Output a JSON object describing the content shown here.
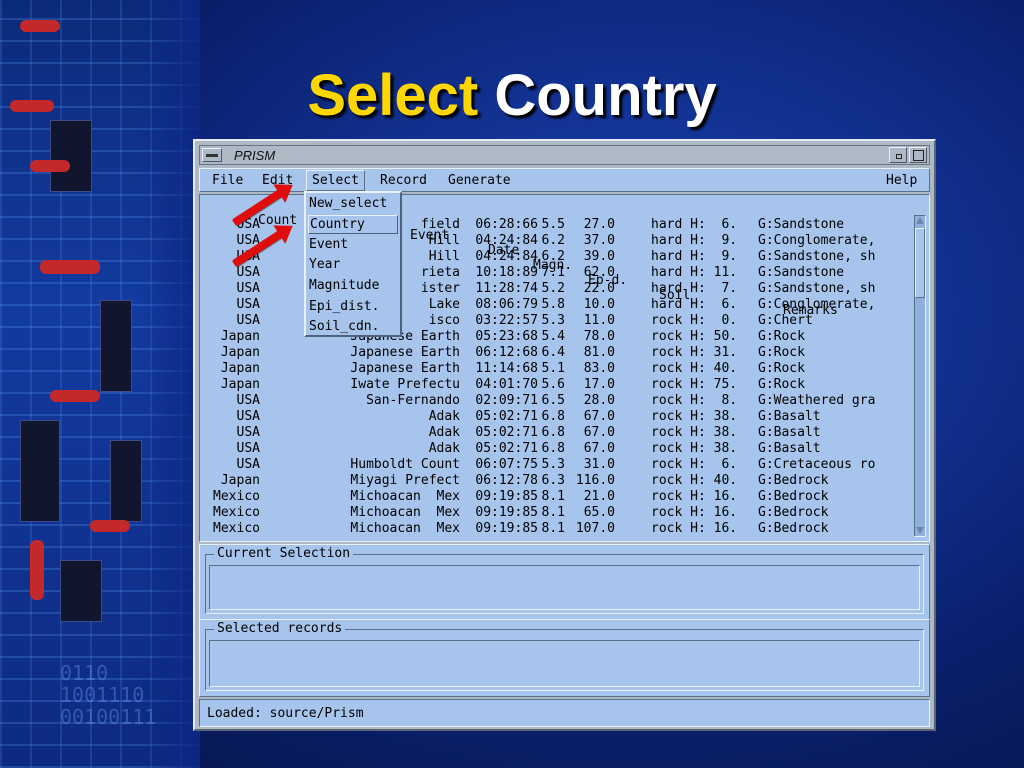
{
  "slide": {
    "title_highlight": "Select",
    "title_rest": "Country"
  },
  "decoration": {
    "binary_text": "0110\n1001110\n00100111"
  },
  "window": {
    "title": "PRISM",
    "menu": {
      "file": "File",
      "edit": "Edit",
      "select": "Select",
      "record": "Record",
      "generate": "Generate",
      "help": "Help"
    }
  },
  "dropdown": {
    "items": [
      "New_select",
      "Country",
      "Event",
      "Year",
      "Magnitude",
      "Epi_dist.",
      "Soil_cdn."
    ],
    "selected": "Country"
  },
  "table": {
    "columns": [
      "Count",
      "Event",
      "Date",
      "Magn.",
      "Ep-d.",
      "Soil",
      "Remarks"
    ],
    "rows": [
      [
        "USA",
        "field",
        "06:28:66",
        "5.5",
        "27.0",
        "hard H:  6.",
        "G:Sandstone"
      ],
      [
        "USA",
        "Hill",
        "04:24:84",
        "6.2",
        "37.0",
        "hard H:  9.",
        "G:Conglomerate,"
      ],
      [
        "USA",
        "Hill",
        "04:24:84",
        "6.2",
        "39.0",
        "hard H:  9.",
        "G:Sandstone, sh"
      ],
      [
        "USA",
        "rieta",
        "10:18:89",
        "7.1",
        "62.0",
        "hard H: 11.",
        "G:Sandstone"
      ],
      [
        "USA",
        "ister",
        "11:28:74",
        "5.2",
        "22.0",
        "hard H:  7.",
        "G:Sandstone, sh"
      ],
      [
        "USA",
        "Lake",
        "08:06:79",
        "5.8",
        "10.0",
        "hard H:  6.",
        "G:Conglomerate,"
      ],
      [
        "USA",
        "isco",
        "03:22:57",
        "5.3",
        "11.0",
        "rock H:  0.",
        "G:Chert"
      ],
      [
        "Japan",
        "Japanese Earth",
        "05:23:68",
        "5.4",
        "78.0",
        "rock H: 50.",
        "G:Rock"
      ],
      [
        "Japan",
        "Japanese Earth",
        "06:12:68",
        "6.4",
        "81.0",
        "rock H: 31.",
        "G:Rock"
      ],
      [
        "Japan",
        "Japanese Earth",
        "11:14:68",
        "5.1",
        "83.0",
        "rock H: 40.",
        "G:Rock"
      ],
      [
        "Japan",
        "Iwate Prefectu",
        "04:01:70",
        "5.6",
        "17.0",
        "rock H: 75.",
        "G:Rock"
      ],
      [
        "USA",
        "San-Fernando",
        "02:09:71",
        "6.5",
        "28.0",
        "rock H:  8.",
        "G:Weathered gra"
      ],
      [
        "USA",
        "Adak",
        "05:02:71",
        "6.8",
        "67.0",
        "rock H: 38.",
        "G:Basalt"
      ],
      [
        "USA",
        "Adak",
        "05:02:71",
        "6.8",
        "67.0",
        "rock H: 38.",
        "G:Basalt"
      ],
      [
        "USA",
        "Adak",
        "05:02:71",
        "6.8",
        "67.0",
        "rock H: 38.",
        "G:Basalt"
      ],
      [
        "USA",
        "Humboldt Count",
        "06:07:75",
        "5.3",
        "31.0",
        "rock H:  6.",
        "G:Cretaceous ro"
      ],
      [
        "Japan",
        "Miyagi Prefect",
        "06:12:78",
        "6.3",
        "116.0",
        "rock H: 40.",
        "G:Bedrock"
      ],
      [
        "Mexico",
        "Michoacan  Mex",
        "09:19:85",
        "8.1",
        "21.0",
        "rock H: 16.",
        "G:Bedrock"
      ],
      [
        "Mexico",
        "Michoacan  Mex",
        "09:19:85",
        "8.1",
        "65.0",
        "rock H: 16.",
        "G:Bedrock"
      ],
      [
        "Mexico",
        "Michoacan  Mex",
        "09:19:85",
        "8.1",
        "107.0",
        "rock H: 16.",
        "G:Bedrock"
      ]
    ]
  },
  "current_selection": {
    "label": "Current Selection",
    "value": ""
  },
  "selected_records": {
    "label": "Selected records",
    "value": ""
  },
  "status": {
    "text": "Loaded: source/Prism"
  },
  "colors": {
    "panel": "#a7c5ec",
    "window": "#aeb9c6",
    "title_highlight": "#ffd700",
    "arrow": "#e00d0d"
  },
  "icons": [
    "window-menu-icon",
    "minimize-icon",
    "maximize-icon",
    "scroll-up-icon",
    "scroll-down-icon",
    "red-arrow-icon"
  ]
}
